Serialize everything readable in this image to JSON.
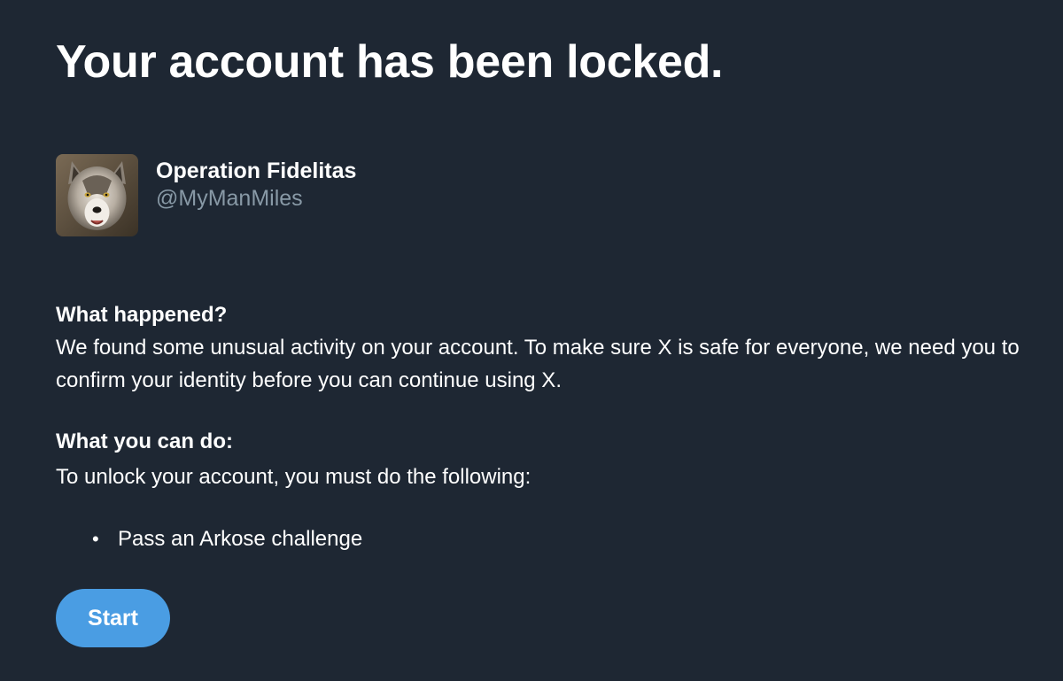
{
  "page": {
    "title": "Your account has been locked."
  },
  "profile": {
    "avatar_icon": "wolf-avatar",
    "display_name": "Operation Fidelitas",
    "handle": "@MyManMiles"
  },
  "what_happened": {
    "heading": "What happened?",
    "text": "We found some unusual activity on your account. To make sure X is safe for everyone, we need you to confirm your identity before you can continue using X."
  },
  "what_you_can_do": {
    "heading": "What you can do:",
    "text": "To unlock your account, you must do the following:",
    "requirements": [
      {
        "bullet": "•",
        "label": "Pass an Arkose challenge"
      }
    ]
  },
  "actions": {
    "start_label": "Start"
  },
  "colors": {
    "background": "#1e2733",
    "text": "#ffffff",
    "secondary_text": "#8899a6",
    "button": "#4a9de3"
  }
}
